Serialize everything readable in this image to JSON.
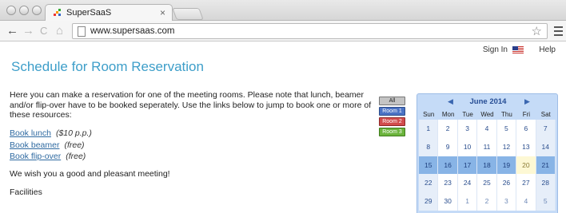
{
  "browser": {
    "tab_title": "SuperSaaS",
    "url": "www.supersaas.com",
    "close_glyph": "×",
    "nav": {
      "back": "←",
      "forward": "→",
      "reload": "C",
      "home": "⌂"
    },
    "star_glyph": "☆"
  },
  "topnav": {
    "signin": "Sign In",
    "help": "Help"
  },
  "page": {
    "title": "Schedule for Room Reservation",
    "intro": "Here you can make a reservation for one of the meeting rooms. Please note that lunch, beamer and/or flip-over have to be booked seperately. Use the links below to jump to book one or more of these resources:",
    "links": [
      {
        "label": "Book lunch",
        "price": "($10 p.p.)"
      },
      {
        "label": "Book beamer",
        "price": "(free)"
      },
      {
        "label": "Book flip-over",
        "price": "(free)"
      }
    ],
    "wish": "We wish you a good and pleasant meeting!",
    "facilities": "Facilities"
  },
  "filters": {
    "all": "All",
    "room1": "Room 1",
    "room2": "Room 2",
    "room3": "Room 3"
  },
  "calendar": {
    "title": "June 2014",
    "prev": "◀",
    "next": "▶",
    "days_of_week": [
      "Sun",
      "Mon",
      "Tue",
      "Wed",
      "Thu",
      "Fri",
      "Sat"
    ],
    "weeks": [
      [
        "1",
        "2",
        "3",
        "4",
        "5",
        "6",
        "7"
      ],
      [
        "8",
        "9",
        "10",
        "11",
        "12",
        "13",
        "14"
      ],
      [
        "15",
        "16",
        "17",
        "18",
        "19",
        "20",
        "21"
      ],
      [
        "22",
        "23",
        "24",
        "25",
        "26",
        "27",
        "28"
      ],
      [
        "29",
        "30",
        "1",
        "2",
        "3",
        "4",
        "5"
      ]
    ]
  }
}
